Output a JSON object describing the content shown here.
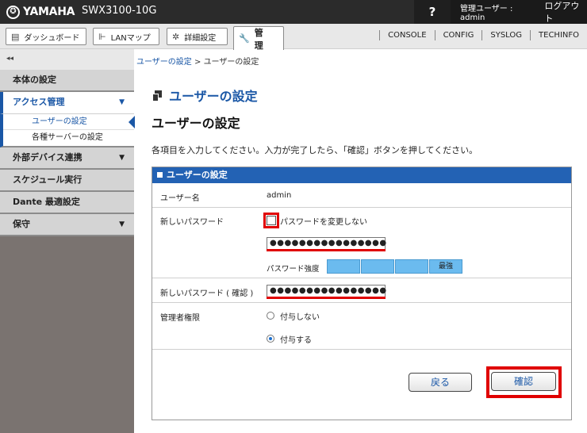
{
  "topbar": {
    "logo_mark": "✪",
    "brand": "YAMAHA",
    "model": "SWX3100-10G",
    "help": "?",
    "user": "管理ユーザー : admin",
    "logout": "ログアウト"
  },
  "toolbar": {
    "tabs": [
      {
        "label": "ダッシュボード",
        "icon": "dashboard-icon"
      },
      {
        "label": "LANマップ",
        "icon": "lan-map-icon"
      },
      {
        "label": "詳細設定",
        "icon": "gear-icon"
      },
      {
        "label": "管　理",
        "icon": "wrench-icon"
      }
    ],
    "links": [
      "CONSOLE",
      "CONFIG",
      "SYSLOG",
      "TECHINFO"
    ]
  },
  "sidebar": {
    "collapse": "◂◂",
    "items": [
      {
        "label": "本体の設定"
      },
      {
        "label": "アクセス管理",
        "open": true,
        "children": [
          {
            "label": "ユーザーの設定",
            "current": true
          },
          {
            "label": "各種サーバーの設定"
          }
        ]
      },
      {
        "label": "外部デバイス連携",
        "caret": "▼"
      },
      {
        "label": "スケジュール実行"
      },
      {
        "label": "Dante 最適設定"
      },
      {
        "label": "保守",
        "caret": "▼"
      }
    ],
    "caret": "▼"
  },
  "breadcrumb": {
    "parent": "ユーザーの設定",
    "sep": " > ",
    "current": "ユーザーの設定"
  },
  "page": {
    "header": "ユーザーの設定",
    "section_title": "ユーザーの設定",
    "instructions": "各項目を入力してください。入力が完了したら、「確認」ボタンを押してください。"
  },
  "panel": {
    "title": "ユーザーの設定",
    "username_label": "ユーザー名",
    "username_value": "admin",
    "new_password_label": "新しいパスワード",
    "no_change_label": "パスワードを変更しない",
    "new_password_value": "●●●●●●●●●●●●●●●●",
    "strength_label": "パスワード強度",
    "strength_text": "最強",
    "confirm_password_label": "新しいパスワード ( 確認 )",
    "confirm_password_value": "●●●●●●●●●●●●●●●●",
    "admin_label": "管理者権限",
    "admin_no": "付与しない",
    "admin_yes": "付与する",
    "back_button": "戻る",
    "confirm_button": "確認"
  },
  "colors": {
    "accent": "#1a57a6",
    "panel_head": "#2362b4",
    "highlight": "#e00000",
    "strength": "#6bbbef"
  }
}
